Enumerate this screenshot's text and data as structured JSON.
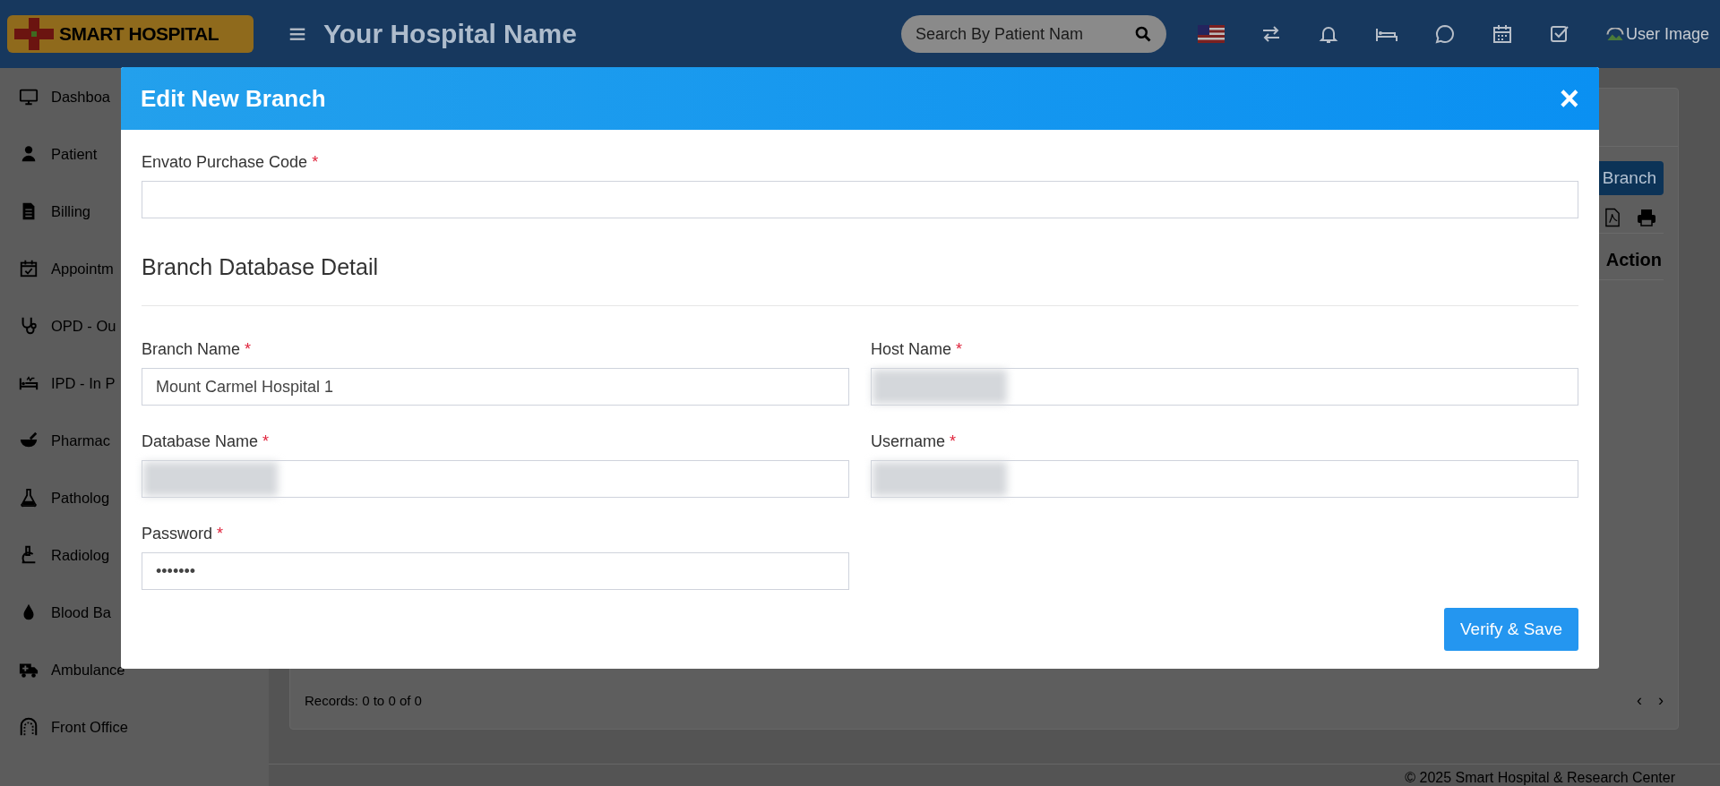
{
  "header": {
    "logo": "SMART HOSPITAL",
    "title": "Your Hospital Name",
    "search": {
      "placeholder": "Search By Patient Nam"
    },
    "user_image": "User Image"
  },
  "sidebar": {
    "items": [
      {
        "label": "Dashboa"
      },
      {
        "label": "Patient"
      },
      {
        "label": "Billing"
      },
      {
        "label": "Appointm"
      },
      {
        "label": "OPD - Ou"
      },
      {
        "label": "IPD - In P"
      },
      {
        "label": "Pharmac"
      },
      {
        "label": "Patholog"
      },
      {
        "label": "Radiolog"
      },
      {
        "label": "Blood Ba"
      },
      {
        "label": "Ambulance"
      },
      {
        "label": "Front Office"
      }
    ]
  },
  "content": {
    "add_button": "Branch",
    "columns": [
      "Action"
    ],
    "records": "Records: 0 to 0 of 0",
    "pager": [
      "‹",
      "›"
    ]
  },
  "footer": "© 2025 Smart Hospital & Research Center",
  "modal": {
    "title": "Edit New Branch",
    "close": "×",
    "purchase_code": {
      "label": "Envato Purchase Code",
      "required_mark": "*"
    },
    "section_title": "Branch Database Detail",
    "fields": [
      {
        "label": "Branch Name",
        "required_mark": "*",
        "value": "Mount Carmel Hospital 1",
        "blurred": false
      },
      {
        "label": "Host Name",
        "required_mark": "*",
        "blurred": true
      },
      {
        "label": "Database Name",
        "required_mark": "*",
        "blurred": true
      },
      {
        "label": "Username",
        "required_mark": "*",
        "blurred": true
      },
      {
        "label": "Password",
        "required_mark": "*",
        "value": "•••••••",
        "blurred": false
      }
    ],
    "save_button": "Verify & Save"
  }
}
